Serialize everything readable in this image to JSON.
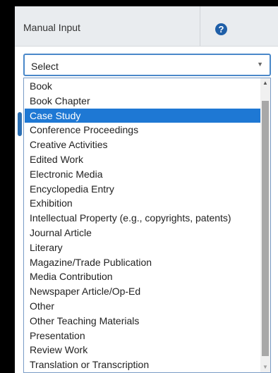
{
  "header": {
    "label": "Manual Input",
    "help_glyph": "?"
  },
  "select": {
    "value": "Select",
    "arrow_glyph": "▼"
  },
  "options": [
    "Book",
    "Book Chapter",
    "Case Study",
    "Conference Proceedings",
    "Creative Activities",
    "Edited Work",
    "Electronic Media",
    "Encyclopedia Entry",
    "Exhibition",
    "Intellectual Property (e.g., copyrights, patents)",
    "Journal Article",
    "Literary",
    "Magazine/Trade Publication",
    "Media Contribution",
    "Newspaper Article/Op-Ed",
    "Other",
    "Other Teaching Materials",
    "Presentation",
    "Review Work",
    "Translation or Transcription"
  ],
  "selected_option": "Case Study",
  "scrollbar": {
    "up_glyph": "▲",
    "down_glyph": "▼"
  },
  "colors": {
    "accent": "#1e78d4",
    "help_icon": "#1f5fa8",
    "header_bg": "#e9ecef",
    "border": "#4a88c9"
  },
  "icons": {
    "help": "question-circle-icon",
    "select_arrow": "chevron-down-icon",
    "scroll_up": "scroll-up-arrow-icon",
    "scroll_down": "scroll-down-arrow-icon"
  }
}
